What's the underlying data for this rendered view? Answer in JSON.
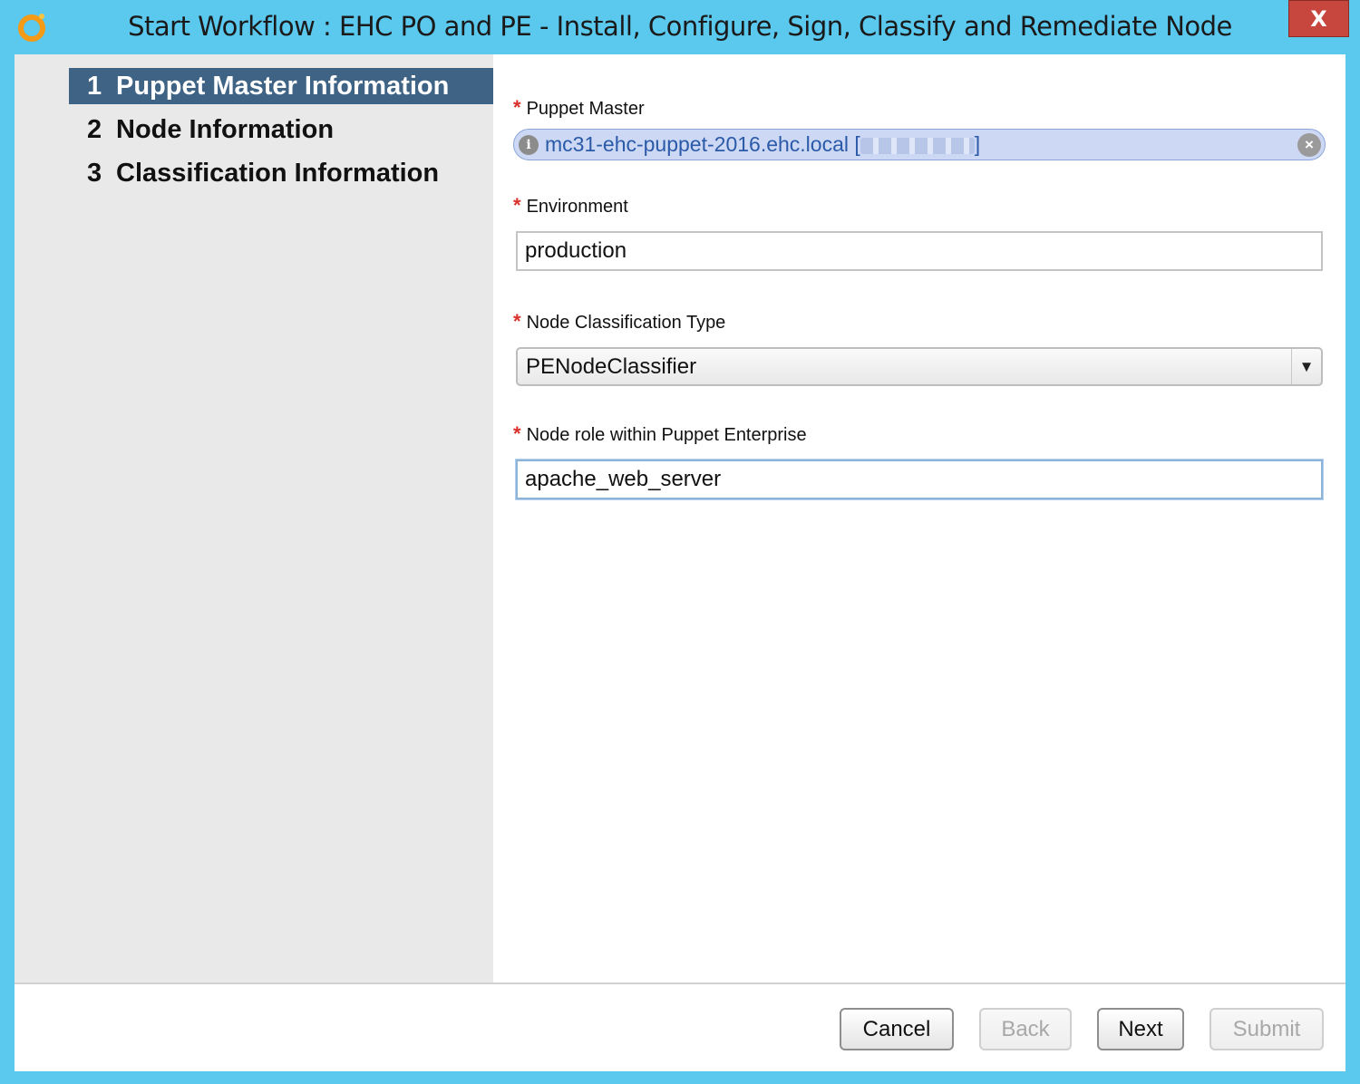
{
  "window": {
    "title": "Start Workflow : EHC PO and PE - Install, Configure, Sign, Classify and Remediate Node",
    "close_label": "X",
    "icon": "orchestrator-logo-icon"
  },
  "steps": [
    {
      "number": "1",
      "label": "Puppet Master Information",
      "active": true
    },
    {
      "number": "2",
      "label": "Node Information",
      "active": false
    },
    {
      "number": "3",
      "label": "Classification Information",
      "active": false
    }
  ],
  "form": {
    "required_marker": "*",
    "puppet_master": {
      "label": "Puppet Master",
      "value": "mc31-ehc-puppet-2016.ehc.local [",
      "value_suffix": "]",
      "info_glyph": "i",
      "clear_glyph": "×"
    },
    "environment": {
      "label": "Environment",
      "value": "production"
    },
    "node_classification_type": {
      "label": "Node Classification Type",
      "value": "PENodeClassifier",
      "arrow": "▼"
    },
    "node_role": {
      "label": "Node role within Puppet Enterprise",
      "value": "apache_web_server"
    }
  },
  "buttons": {
    "cancel": "Cancel",
    "back": "Back",
    "next": "Next",
    "submit": "Submit"
  },
  "colors": {
    "titlebar": "#5bc8ee",
    "close_button": "#c7463e",
    "active_step": "#3f6385",
    "sidebar": "#e9e9e9",
    "required": "#d9302c"
  }
}
